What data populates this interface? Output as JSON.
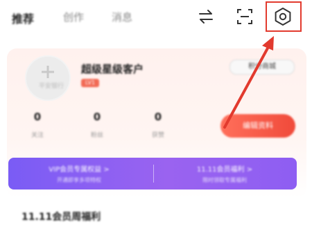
{
  "tabs": [
    {
      "label": "推荐",
      "active": true
    },
    {
      "label": "创作",
      "active": false
    },
    {
      "label": "消息",
      "active": false
    }
  ],
  "top_icons": [
    "swap-icon",
    "scan-icon",
    "settings-icon"
  ],
  "profile": {
    "avatar_label": "平安银行",
    "username": "超级星级客户",
    "level_tag": "LV1",
    "badge": "积分商城"
  },
  "stats": [
    {
      "value": "0",
      "label": "关注"
    },
    {
      "value": "0",
      "label": "粉丝"
    },
    {
      "value": "0",
      "label": "获赞"
    }
  ],
  "action_button": "编辑资料",
  "banner": {
    "left": {
      "title": "VIP会员专属权益 >",
      "subtitle": "开通即享多项特权"
    },
    "right": {
      "title": "11.11会员福利 >",
      "subtitle": "限时领取专属福利"
    }
  },
  "section_title": "11.11会员周福利",
  "colors": {
    "accent": "#f04a3a",
    "banner": "#8e5ef2",
    "highlight": "#e23a2e"
  }
}
